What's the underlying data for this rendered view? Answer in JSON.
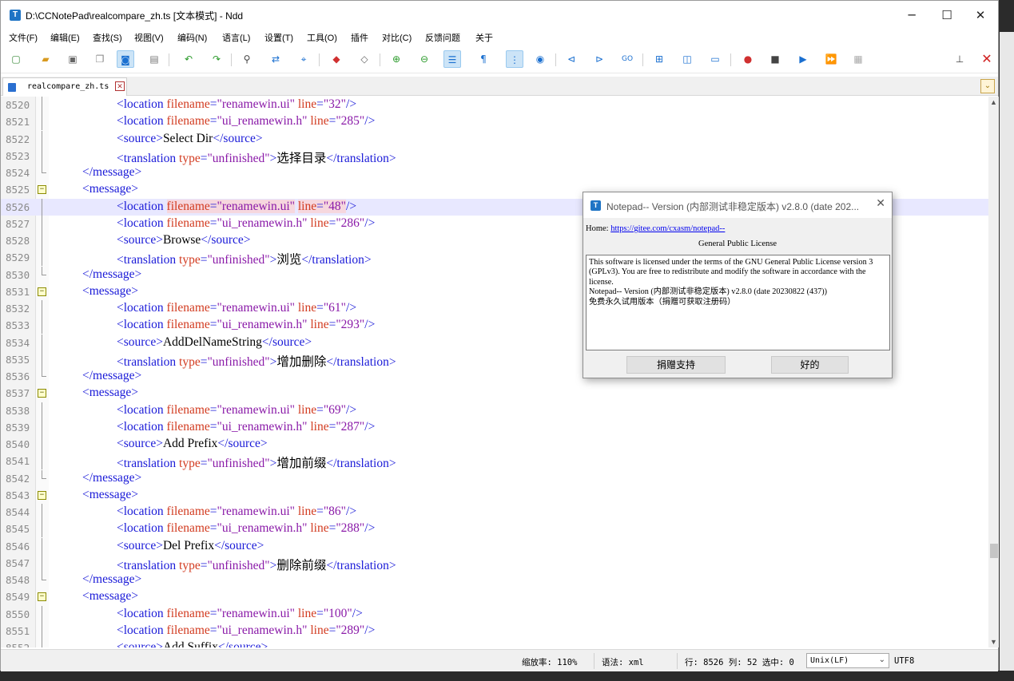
{
  "window": {
    "title": "D:\\CCNotePad\\realcompare_zh.ts [文本模式] - Ndd",
    "app_icon": "T"
  },
  "menu": [
    "文件(F)",
    "编辑(E)",
    "查找(S)",
    "视图(V)",
    "编码(N)",
    "语言(L)",
    "设置(T)",
    "工具(O)",
    "插件",
    "对比(C)",
    "反馈问题",
    "关于"
  ],
  "tab": {
    "label": "realcompare_zh.ts"
  },
  "editor": {
    "active_line": "8526",
    "lines": [
      {
        "n": "8520",
        "fold": "line",
        "indent": 2,
        "parts": [
          [
            "tag",
            "<location "
          ],
          [
            "attr",
            "filename"
          ],
          [
            "tag",
            "="
          ],
          [
            "val",
            "\"renamewin.ui\""
          ],
          [
            "tag",
            " "
          ],
          [
            "attr",
            "line"
          ],
          [
            "tag",
            "="
          ],
          [
            "val",
            "\"32\""
          ],
          [
            "tag",
            "/>"
          ]
        ]
      },
      {
        "n": "8521",
        "fold": "line",
        "indent": 2,
        "parts": [
          [
            "tag",
            "<location "
          ],
          [
            "attr",
            "filename"
          ],
          [
            "tag",
            "="
          ],
          [
            "val",
            "\"ui_renamewin.h\""
          ],
          [
            "tag",
            " "
          ],
          [
            "attr",
            "line"
          ],
          [
            "tag",
            "="
          ],
          [
            "val",
            "\"285\""
          ],
          [
            "tag",
            "/>"
          ]
        ]
      },
      {
        "n": "8522",
        "fold": "line",
        "indent": 2,
        "parts": [
          [
            "tag",
            "<source>"
          ],
          [
            "txt",
            "Select Dir"
          ],
          [
            "tag",
            "</source>"
          ]
        ]
      },
      {
        "n": "8523",
        "fold": "line",
        "indent": 2,
        "parts": [
          [
            "tag",
            "<translation "
          ],
          [
            "attr",
            "type"
          ],
          [
            "tag",
            "="
          ],
          [
            "val",
            "\"unfinished\""
          ],
          [
            "tag",
            ">"
          ],
          [
            "txt",
            "选择目录"
          ],
          [
            "tag",
            "</translation>"
          ]
        ]
      },
      {
        "n": "8524",
        "fold": "end",
        "indent": 1,
        "parts": [
          [
            "tag",
            "</message>"
          ]
        ]
      },
      {
        "n": "8525",
        "fold": "box",
        "indent": 1,
        "parts": [
          [
            "tag",
            "<message>"
          ]
        ]
      },
      {
        "n": "8526",
        "fold": "line",
        "indent": 2,
        "parts": [
          [
            "tag",
            "<location "
          ],
          [
            "attr",
            "filename"
          ],
          [
            "tag",
            "="
          ],
          [
            "val",
            "\"renamewin.ui\""
          ],
          [
            "tag",
            " "
          ],
          [
            "attr",
            "line"
          ],
          [
            "tag",
            "="
          ],
          [
            "val",
            "\"48\""
          ],
          [
            "tag",
            "/>"
          ]
        ]
      },
      {
        "n": "8527",
        "fold": "line",
        "indent": 2,
        "parts": [
          [
            "tag",
            "<location "
          ],
          [
            "attr",
            "filename"
          ],
          [
            "tag",
            "="
          ],
          [
            "val",
            "\"ui_renamewin.h\""
          ],
          [
            "tag",
            " "
          ],
          [
            "attr",
            "line"
          ],
          [
            "tag",
            "="
          ],
          [
            "val",
            "\"286\""
          ],
          [
            "tag",
            "/>"
          ]
        ]
      },
      {
        "n": "8528",
        "fold": "line",
        "indent": 2,
        "parts": [
          [
            "tag",
            "<source>"
          ],
          [
            "txt",
            "Browse"
          ],
          [
            "tag",
            "</source>"
          ]
        ]
      },
      {
        "n": "8529",
        "fold": "line",
        "indent": 2,
        "parts": [
          [
            "tag",
            "<translation "
          ],
          [
            "attr",
            "type"
          ],
          [
            "tag",
            "="
          ],
          [
            "val",
            "\"unfinished\""
          ],
          [
            "tag",
            ">"
          ],
          [
            "txt",
            "浏览"
          ],
          [
            "tag",
            "</translation>"
          ]
        ]
      },
      {
        "n": "8530",
        "fold": "end",
        "indent": 1,
        "parts": [
          [
            "tag",
            "</message>"
          ]
        ]
      },
      {
        "n": "8531",
        "fold": "box",
        "indent": 1,
        "parts": [
          [
            "tag",
            "<message>"
          ]
        ]
      },
      {
        "n": "8532",
        "fold": "line",
        "indent": 2,
        "parts": [
          [
            "tag",
            "<location "
          ],
          [
            "attr",
            "filename"
          ],
          [
            "tag",
            "="
          ],
          [
            "val",
            "\"renamewin.ui\""
          ],
          [
            "tag",
            " "
          ],
          [
            "attr",
            "line"
          ],
          [
            "tag",
            "="
          ],
          [
            "val",
            "\"61\""
          ],
          [
            "tag",
            "/>"
          ]
        ]
      },
      {
        "n": "8533",
        "fold": "line",
        "indent": 2,
        "parts": [
          [
            "tag",
            "<location "
          ],
          [
            "attr",
            "filename"
          ],
          [
            "tag",
            "="
          ],
          [
            "val",
            "\"ui_renamewin.h\""
          ],
          [
            "tag",
            " "
          ],
          [
            "attr",
            "line"
          ],
          [
            "tag",
            "="
          ],
          [
            "val",
            "\"293\""
          ],
          [
            "tag",
            "/>"
          ]
        ]
      },
      {
        "n": "8534",
        "fold": "line",
        "indent": 2,
        "parts": [
          [
            "tag",
            "<source>"
          ],
          [
            "txt",
            "AddDelNameString"
          ],
          [
            "tag",
            "</source>"
          ]
        ]
      },
      {
        "n": "8535",
        "fold": "line",
        "indent": 2,
        "parts": [
          [
            "tag",
            "<translation "
          ],
          [
            "attr",
            "type"
          ],
          [
            "tag",
            "="
          ],
          [
            "val",
            "\"unfinished\""
          ],
          [
            "tag",
            ">"
          ],
          [
            "txt",
            "增加删除"
          ],
          [
            "tag",
            "</translation>"
          ]
        ]
      },
      {
        "n": "8536",
        "fold": "end",
        "indent": 1,
        "parts": [
          [
            "tag",
            "</message>"
          ]
        ]
      },
      {
        "n": "8537",
        "fold": "box",
        "indent": 1,
        "parts": [
          [
            "tag",
            "<message>"
          ]
        ]
      },
      {
        "n": "8538",
        "fold": "line",
        "indent": 2,
        "parts": [
          [
            "tag",
            "<location "
          ],
          [
            "attr",
            "filename"
          ],
          [
            "tag",
            "="
          ],
          [
            "val",
            "\"renamewin.ui\""
          ],
          [
            "tag",
            " "
          ],
          [
            "attr",
            "line"
          ],
          [
            "tag",
            "="
          ],
          [
            "val",
            "\"69\""
          ],
          [
            "tag",
            "/>"
          ]
        ]
      },
      {
        "n": "8539",
        "fold": "line",
        "indent": 2,
        "parts": [
          [
            "tag",
            "<location "
          ],
          [
            "attr",
            "filename"
          ],
          [
            "tag",
            "="
          ],
          [
            "val",
            "\"ui_renamewin.h\""
          ],
          [
            "tag",
            " "
          ],
          [
            "attr",
            "line"
          ],
          [
            "tag",
            "="
          ],
          [
            "val",
            "\"287\""
          ],
          [
            "tag",
            "/>"
          ]
        ]
      },
      {
        "n": "8540",
        "fold": "line",
        "indent": 2,
        "parts": [
          [
            "tag",
            "<source>"
          ],
          [
            "txt",
            "Add Prefix"
          ],
          [
            "tag",
            "</source>"
          ]
        ]
      },
      {
        "n": "8541",
        "fold": "line",
        "indent": 2,
        "parts": [
          [
            "tag",
            "<translation "
          ],
          [
            "attr",
            "type"
          ],
          [
            "tag",
            "="
          ],
          [
            "val",
            "\"unfinished\""
          ],
          [
            "tag",
            ">"
          ],
          [
            "txt",
            "增加前缀"
          ],
          [
            "tag",
            "</translation>"
          ]
        ]
      },
      {
        "n": "8542",
        "fold": "end",
        "indent": 1,
        "parts": [
          [
            "tag",
            "</message>"
          ]
        ]
      },
      {
        "n": "8543",
        "fold": "box",
        "indent": 1,
        "parts": [
          [
            "tag",
            "<message>"
          ]
        ]
      },
      {
        "n": "8544",
        "fold": "line",
        "indent": 2,
        "parts": [
          [
            "tag",
            "<location "
          ],
          [
            "attr",
            "filename"
          ],
          [
            "tag",
            "="
          ],
          [
            "val",
            "\"renamewin.ui\""
          ],
          [
            "tag",
            " "
          ],
          [
            "attr",
            "line"
          ],
          [
            "tag",
            "="
          ],
          [
            "val",
            "\"86\""
          ],
          [
            "tag",
            "/>"
          ]
        ]
      },
      {
        "n": "8545",
        "fold": "line",
        "indent": 2,
        "parts": [
          [
            "tag",
            "<location "
          ],
          [
            "attr",
            "filename"
          ],
          [
            "tag",
            "="
          ],
          [
            "val",
            "\"ui_renamewin.h\""
          ],
          [
            "tag",
            " "
          ],
          [
            "attr",
            "line"
          ],
          [
            "tag",
            "="
          ],
          [
            "val",
            "\"288\""
          ],
          [
            "tag",
            "/>"
          ]
        ]
      },
      {
        "n": "8546",
        "fold": "line",
        "indent": 2,
        "parts": [
          [
            "tag",
            "<source>"
          ],
          [
            "txt",
            "Del Prefix"
          ],
          [
            "tag",
            "</source>"
          ]
        ]
      },
      {
        "n": "8547",
        "fold": "line",
        "indent": 2,
        "parts": [
          [
            "tag",
            "<translation "
          ],
          [
            "attr",
            "type"
          ],
          [
            "tag",
            "="
          ],
          [
            "val",
            "\"unfinished\""
          ],
          [
            "tag",
            ">"
          ],
          [
            "txt",
            "删除前缀"
          ],
          [
            "tag",
            "</translation>"
          ]
        ]
      },
      {
        "n": "8548",
        "fold": "end",
        "indent": 1,
        "parts": [
          [
            "tag",
            "</message>"
          ]
        ]
      },
      {
        "n": "8549",
        "fold": "box",
        "indent": 1,
        "parts": [
          [
            "tag",
            "<message>"
          ]
        ]
      },
      {
        "n": "8550",
        "fold": "line",
        "indent": 2,
        "parts": [
          [
            "tag",
            "<location "
          ],
          [
            "attr",
            "filename"
          ],
          [
            "tag",
            "="
          ],
          [
            "val",
            "\"renamewin.ui\""
          ],
          [
            "tag",
            " "
          ],
          [
            "attr",
            "line"
          ],
          [
            "tag",
            "="
          ],
          [
            "val",
            "\"100\""
          ],
          [
            "tag",
            "/>"
          ]
        ]
      },
      {
        "n": "8551",
        "fold": "line",
        "indent": 2,
        "parts": [
          [
            "tag",
            "<location "
          ],
          [
            "attr",
            "filename"
          ],
          [
            "tag",
            "="
          ],
          [
            "val",
            "\"ui_renamewin.h\""
          ],
          [
            "tag",
            " "
          ],
          [
            "attr",
            "line"
          ],
          [
            "tag",
            "="
          ],
          [
            "val",
            "\"289\""
          ],
          [
            "tag",
            "/>"
          ]
        ]
      },
      {
        "n": "8552",
        "fold": "line",
        "indent": 2,
        "parts": [
          [
            "tag",
            "<source>"
          ],
          [
            "txt",
            "Add Suffix"
          ],
          [
            "tag",
            "</source>"
          ]
        ]
      }
    ]
  },
  "status": {
    "zoom": "缩放率: 110%",
    "syntax": "语法: xml",
    "position": "行: 8526 列: 52 选中: 0",
    "eol": "Unix(LF)",
    "encoding": "UTF8"
  },
  "dialog": {
    "title": "Notepad-- Version (内部测试非稳定版本) v2.8.0 (date 202...",
    "home_label": "Home: ",
    "home_url": "https://gitee.com/cxasm/notepad--",
    "license_heading": "General Public License",
    "license_text": "This software is licensed under the terms of the GNU General Public License version 3 (GPLv3). You are free to redistribute and modify the software in accordance with the license.\nNotepad-- Version (内部测试非稳定版本) v2.8.0 (date 20230822 (437))\n免费永久试用版本（捐赠可获取注册码）",
    "donate_button": "捐赠支持",
    "ok_button": "好的"
  },
  "colors": {
    "tag": "#1a1ad8",
    "attribute": "#d23b20",
    "value": "#8a1aa8",
    "active_line": "#e8e8ff"
  }
}
